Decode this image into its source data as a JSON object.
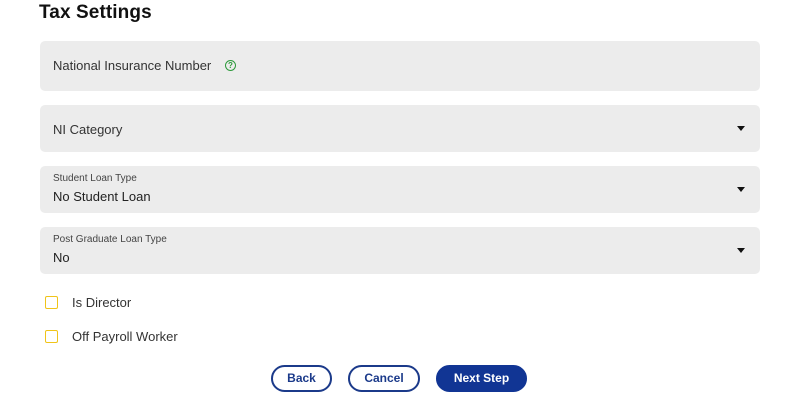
{
  "page": {
    "title": "Tax Settings"
  },
  "fields": {
    "ni_number": {
      "label": "National Insurance Number",
      "help_icon": "question-circle-icon"
    },
    "ni_category": {
      "label": "NI Category"
    },
    "student_loan": {
      "label": "Student Loan Type",
      "value": "No Student Loan"
    },
    "postgrad_loan": {
      "label": "Post Graduate Loan Type",
      "value": "No"
    }
  },
  "checkboxes": {
    "is_director": {
      "label": "Is Director",
      "checked": false
    },
    "off_payroll": {
      "label": "Off Payroll Worker",
      "checked": false
    }
  },
  "buttons": {
    "back": "Back",
    "cancel": "Cancel",
    "next": "Next Step"
  },
  "colors": {
    "field_background": "#ececec",
    "primary": "#113594",
    "checkbox_border": "#f0c419",
    "help_icon": "#2e9a3c"
  }
}
